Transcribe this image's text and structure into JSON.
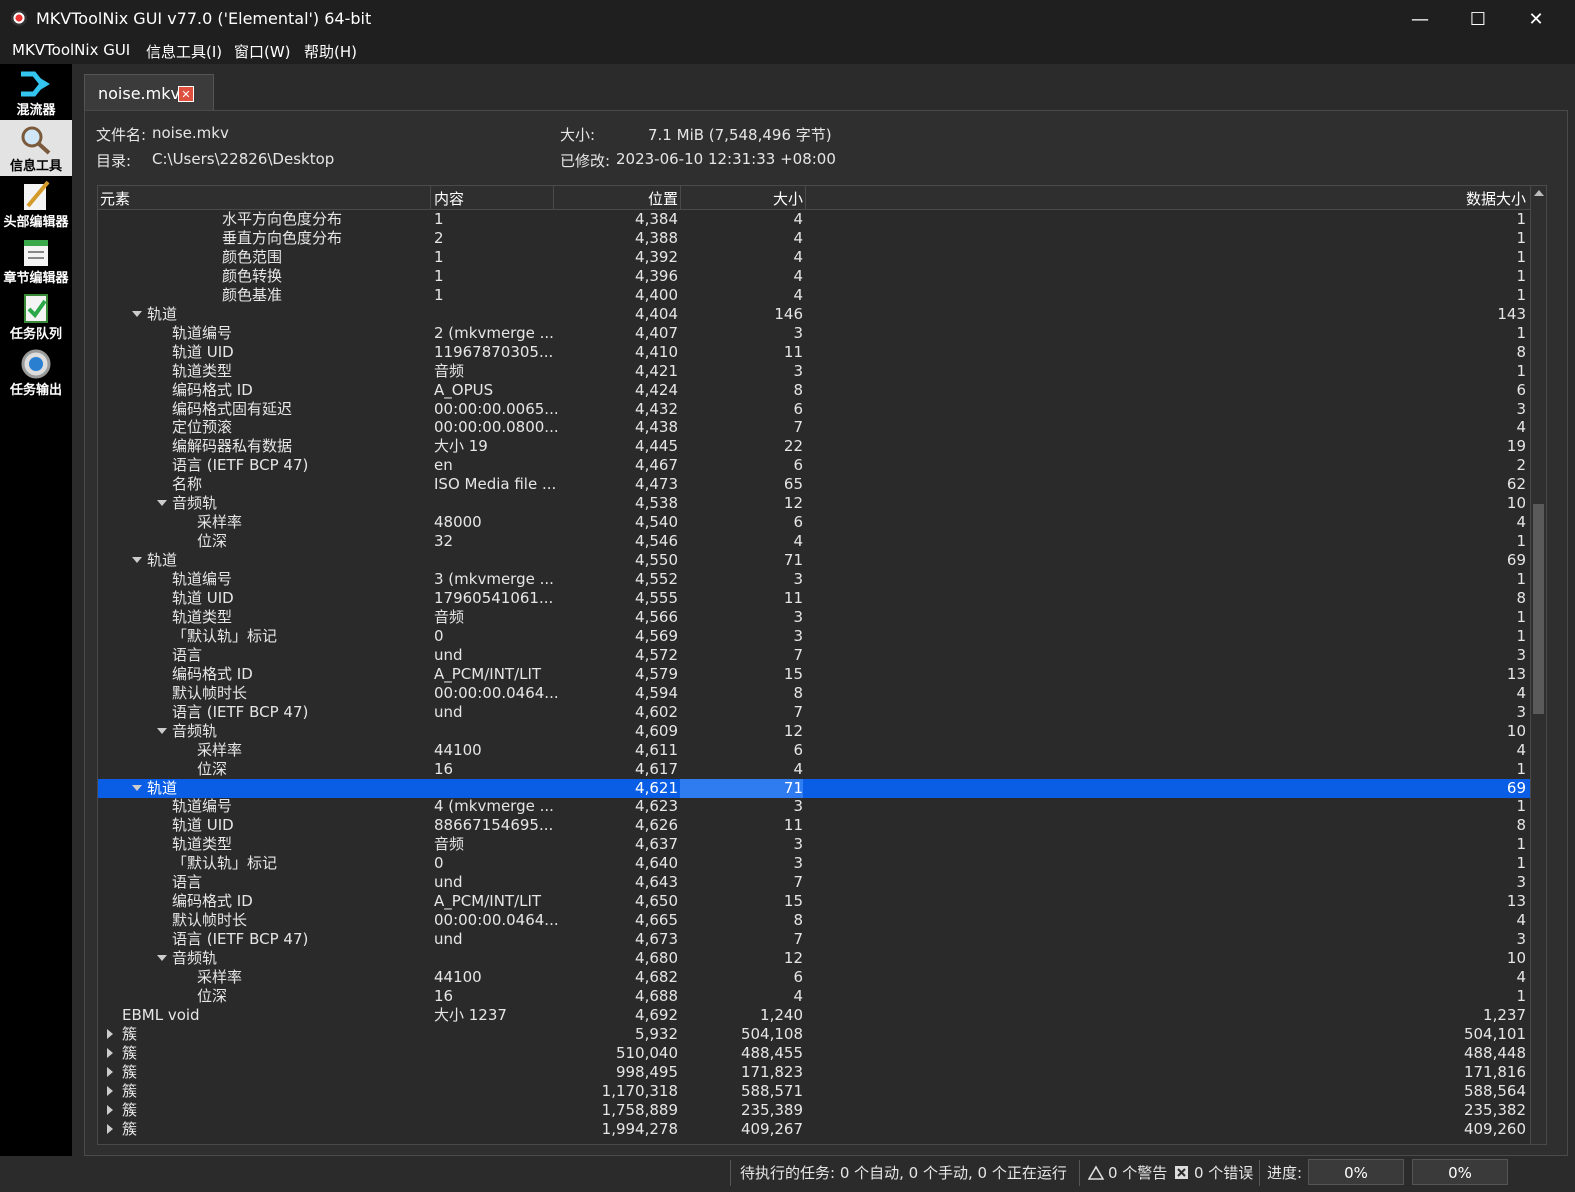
{
  "window": {
    "title": "MKVToolNix GUI v77.0 ('Elemental') 64-bit"
  },
  "menu": [
    "MKVToolNix GUI",
    "信息工具(I)",
    "窗口(W)",
    "帮助(H)"
  ],
  "sidebar": [
    {
      "label": "混流器",
      "icon": "mixer-icon"
    },
    {
      "label": "信息工具",
      "icon": "info-tool-icon"
    },
    {
      "label": "头部编辑器",
      "icon": "header-editor-icon"
    },
    {
      "label": "章节编辑器",
      "icon": "chapter-editor-icon"
    },
    {
      "label": "任务队列",
      "icon": "job-queue-icon"
    },
    {
      "label": "任务输出",
      "icon": "job-output-icon"
    }
  ],
  "tab": {
    "label": "noise.mkv"
  },
  "file_info": {
    "filename_label": "文件名:",
    "filename": "noise.mkv",
    "dir_label": "目录:",
    "dir": "C:\\Users\\22826\\Desktop",
    "size_label": "大小:",
    "size": "7.1 MiB (7,548,496 字节)",
    "modified_label": "已修改:",
    "modified": "2023-06-10 12:31:33 +08:00"
  },
  "columns": [
    "元素",
    "内容",
    "位置",
    "大小",
    "数据大小"
  ],
  "rows": [
    {
      "indent": 6,
      "expander": "",
      "name": "水平方向色度分布",
      "content": "1",
      "pos": "4,384",
      "size": "4",
      "data": "1"
    },
    {
      "indent": 6,
      "expander": "",
      "name": "垂直方向色度分布",
      "content": "2",
      "pos": "4,388",
      "size": "4",
      "data": "1"
    },
    {
      "indent": 6,
      "expander": "",
      "name": "颜色范围",
      "content": "1",
      "pos": "4,392",
      "size": "4",
      "data": "1"
    },
    {
      "indent": 6,
      "expander": "",
      "name": "颜色转换",
      "content": "1",
      "pos": "4,396",
      "size": "4",
      "data": "1"
    },
    {
      "indent": 6,
      "expander": "",
      "name": "颜色基准",
      "content": "1",
      "pos": "4,400",
      "size": "4",
      "data": "1"
    },
    {
      "indent": 3,
      "expander": "down",
      "name": "轨道",
      "content": "",
      "pos": "4,404",
      "size": "146",
      "data": "143"
    },
    {
      "indent": 4,
      "expander": "",
      "name": "轨道编号",
      "content": "2 (mkvmerge ...",
      "pos": "4,407",
      "size": "3",
      "data": "1"
    },
    {
      "indent": 4,
      "expander": "",
      "name": "轨道 UID",
      "content": "11967870305...",
      "pos": "4,410",
      "size": "11",
      "data": "8"
    },
    {
      "indent": 4,
      "expander": "",
      "name": "轨道类型",
      "content": "音频",
      "pos": "4,421",
      "size": "3",
      "data": "1"
    },
    {
      "indent": 4,
      "expander": "",
      "name": "编码格式 ID",
      "content": "A_OPUS",
      "pos": "4,424",
      "size": "8",
      "data": "6"
    },
    {
      "indent": 4,
      "expander": "",
      "name": "编码格式固有延迟",
      "content": "00:00:00.0065...",
      "pos": "4,432",
      "size": "6",
      "data": "3"
    },
    {
      "indent": 4,
      "expander": "",
      "name": "定位预滚",
      "content": "00:00:00.0800...",
      "pos": "4,438",
      "size": "7",
      "data": "4"
    },
    {
      "indent": 4,
      "expander": "",
      "name": "编解码器私有数据",
      "content": "大小 19",
      "pos": "4,445",
      "size": "22",
      "data": "19"
    },
    {
      "indent": 4,
      "expander": "",
      "name": "语言 (IETF BCP 47)",
      "content": "en",
      "pos": "4,467",
      "size": "6",
      "data": "2"
    },
    {
      "indent": 4,
      "expander": "",
      "name": "名称",
      "content": "ISO Media file ...",
      "pos": "4,473",
      "size": "65",
      "data": "62"
    },
    {
      "indent": 4,
      "expander": "down",
      "name": "音频轨",
      "content": "",
      "pos": "4,538",
      "size": "12",
      "data": "10"
    },
    {
      "indent": 5,
      "expander": "",
      "name": "采样率",
      "content": "48000",
      "pos": "4,540",
      "size": "6",
      "data": "4"
    },
    {
      "indent": 5,
      "expander": "",
      "name": "位深",
      "content": "32",
      "pos": "4,546",
      "size": "4",
      "data": "1"
    },
    {
      "indent": 3,
      "expander": "down",
      "name": "轨道",
      "content": "",
      "pos": "4,550",
      "size": "71",
      "data": "69"
    },
    {
      "indent": 4,
      "expander": "",
      "name": "轨道编号",
      "content": "3 (mkvmerge ...",
      "pos": "4,552",
      "size": "3",
      "data": "1"
    },
    {
      "indent": 4,
      "expander": "",
      "name": "轨道 UID",
      "content": "17960541061...",
      "pos": "4,555",
      "size": "11",
      "data": "8"
    },
    {
      "indent": 4,
      "expander": "",
      "name": "轨道类型",
      "content": "音频",
      "pos": "4,566",
      "size": "3",
      "data": "1"
    },
    {
      "indent": 4,
      "expander": "",
      "name": "「默认轨」标记",
      "content": "0",
      "pos": "4,569",
      "size": "3",
      "data": "1"
    },
    {
      "indent": 4,
      "expander": "",
      "name": "语言",
      "content": "und",
      "pos": "4,572",
      "size": "7",
      "data": "3"
    },
    {
      "indent": 4,
      "expander": "",
      "name": "编码格式 ID",
      "content": "A_PCM/INT/LIT",
      "pos": "4,579",
      "size": "15",
      "data": "13"
    },
    {
      "indent": 4,
      "expander": "",
      "name": "默认帧时长",
      "content": "00:00:00.0464...",
      "pos": "4,594",
      "size": "8",
      "data": "4"
    },
    {
      "indent": 4,
      "expander": "",
      "name": "语言 (IETF BCP 47)",
      "content": "und",
      "pos": "4,602",
      "size": "7",
      "data": "3"
    },
    {
      "indent": 4,
      "expander": "down",
      "name": "音频轨",
      "content": "",
      "pos": "4,609",
      "size": "12",
      "data": "10"
    },
    {
      "indent": 5,
      "expander": "",
      "name": "采样率",
      "content": "44100",
      "pos": "4,611",
      "size": "6",
      "data": "4"
    },
    {
      "indent": 5,
      "expander": "",
      "name": "位深",
      "content": "16",
      "pos": "4,617",
      "size": "4",
      "data": "1"
    },
    {
      "indent": 3,
      "expander": "down",
      "name": "轨道",
      "content": "",
      "pos": "4,621",
      "size": "71",
      "data": "69",
      "selected": true
    },
    {
      "indent": 4,
      "expander": "",
      "name": "轨道编号",
      "content": "4 (mkvmerge ...",
      "pos": "4,623",
      "size": "3",
      "data": "1"
    },
    {
      "indent": 4,
      "expander": "",
      "name": "轨道 UID",
      "content": "88667154695...",
      "pos": "4,626",
      "size": "11",
      "data": "8"
    },
    {
      "indent": 4,
      "expander": "",
      "name": "轨道类型",
      "content": "音频",
      "pos": "4,637",
      "size": "3",
      "data": "1"
    },
    {
      "indent": 4,
      "expander": "",
      "name": "「默认轨」标记",
      "content": "0",
      "pos": "4,640",
      "size": "3",
      "data": "1"
    },
    {
      "indent": 4,
      "expander": "",
      "name": "语言",
      "content": "und",
      "pos": "4,643",
      "size": "7",
      "data": "3"
    },
    {
      "indent": 4,
      "expander": "",
      "name": "编码格式 ID",
      "content": "A_PCM/INT/LIT",
      "pos": "4,650",
      "size": "15",
      "data": "13"
    },
    {
      "indent": 4,
      "expander": "",
      "name": "默认帧时长",
      "content": "00:00:00.0464...",
      "pos": "4,665",
      "size": "8",
      "data": "4"
    },
    {
      "indent": 4,
      "expander": "",
      "name": "语言 (IETF BCP 47)",
      "content": "und",
      "pos": "4,673",
      "size": "7",
      "data": "3"
    },
    {
      "indent": 4,
      "expander": "down",
      "name": "音频轨",
      "content": "",
      "pos": "4,680",
      "size": "12",
      "data": "10"
    },
    {
      "indent": 5,
      "expander": "",
      "name": "采样率",
      "content": "44100",
      "pos": "4,682",
      "size": "6",
      "data": "4"
    },
    {
      "indent": 5,
      "expander": "",
      "name": "位深",
      "content": "16",
      "pos": "4,688",
      "size": "4",
      "data": "1"
    },
    {
      "indent": 2,
      "expander": "",
      "name": "EBML void",
      "content": "大小 1237",
      "pos": "4,692",
      "size": "1,240",
      "data": "1,237"
    },
    {
      "indent": 2,
      "expander": "right",
      "name": "簇",
      "content": "",
      "pos": "5,932",
      "size": "504,108",
      "data": "504,101"
    },
    {
      "indent": 2,
      "expander": "right",
      "name": "簇",
      "content": "",
      "pos": "510,040",
      "size": "488,455",
      "data": "488,448"
    },
    {
      "indent": 2,
      "expander": "right",
      "name": "簇",
      "content": "",
      "pos": "998,495",
      "size": "171,823",
      "data": "171,816"
    },
    {
      "indent": 2,
      "expander": "right",
      "name": "簇",
      "content": "",
      "pos": "1,170,318",
      "size": "588,571",
      "data": "588,564"
    },
    {
      "indent": 2,
      "expander": "right",
      "name": "簇",
      "content": "",
      "pos": "1,758,889",
      "size": "235,389",
      "data": "235,382"
    },
    {
      "indent": 2,
      "expander": "right",
      "name": "簇",
      "content": "",
      "pos": "1,994,278",
      "size": "409,267",
      "data": "409,260"
    }
  ],
  "scroll_position": 0.42,
  "status": {
    "tasks": "待执行的任务: 0 个自动, 0 个手动, 0 个正在运行",
    "warnings": "0 个警告",
    "errors": "0 个错误",
    "progress_label": "进度:",
    "progress1": "0%",
    "progress2": "0%"
  },
  "colors": {
    "selection": "#0a5ee6",
    "background": "#2b2b2b",
    "sidebar": "#000000"
  }
}
